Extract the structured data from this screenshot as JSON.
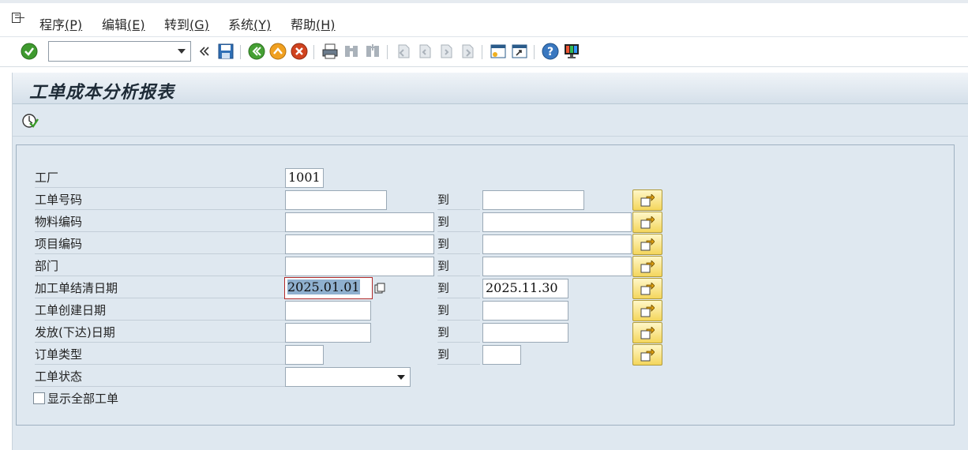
{
  "menu": {
    "items": [
      {
        "label": "程序",
        "accel": "(P)"
      },
      {
        "label": "编辑",
        "accel": "(E)"
      },
      {
        "label": "转到",
        "accel": "(G)"
      },
      {
        "label": "系统",
        "accel": "(Y)"
      },
      {
        "label": "帮助",
        "accel": "(H)"
      }
    ]
  },
  "toolbar": {
    "command_field_value": "",
    "icons": [
      "enter-icon",
      "save-icon",
      "back-icon",
      "exit-icon",
      "cancel-icon",
      "print-icon",
      "find-icon",
      "find-next-icon",
      "first-page-icon",
      "previous-page-icon",
      "next-page-icon",
      "last-page-icon",
      "create-session-icon",
      "shortcut-icon",
      "help-icon",
      "customize-layout-icon"
    ]
  },
  "page": {
    "title": "工单成本分析报表"
  },
  "form": {
    "to_label": "到",
    "fields": [
      {
        "label": "工厂",
        "low": "1001",
        "high": null
      },
      {
        "label": "工单号码",
        "low": "",
        "high": ""
      },
      {
        "label": "物料编码",
        "low": "",
        "high": ""
      },
      {
        "label": "项目编码",
        "low": "",
        "high": ""
      },
      {
        "label": "部门",
        "low": "",
        "high": ""
      },
      {
        "label": "加工单结清日期",
        "low": "2025.01.01",
        "high": "2025.11.30"
      },
      {
        "label": "工单创建日期",
        "low": "",
        "high": ""
      },
      {
        "label": "发放(下达)日期",
        "low": "",
        "high": ""
      },
      {
        "label": "订单类型",
        "low": "",
        "high": ""
      },
      {
        "label": "工单状态",
        "low": "",
        "high": null
      }
    ],
    "show_all_label": "显示全部工单",
    "show_all_checked": false
  },
  "colors": {
    "accent": "#2a5b8a",
    "multi_select_button": "#f4d65c",
    "background": "#dfe8f0"
  }
}
